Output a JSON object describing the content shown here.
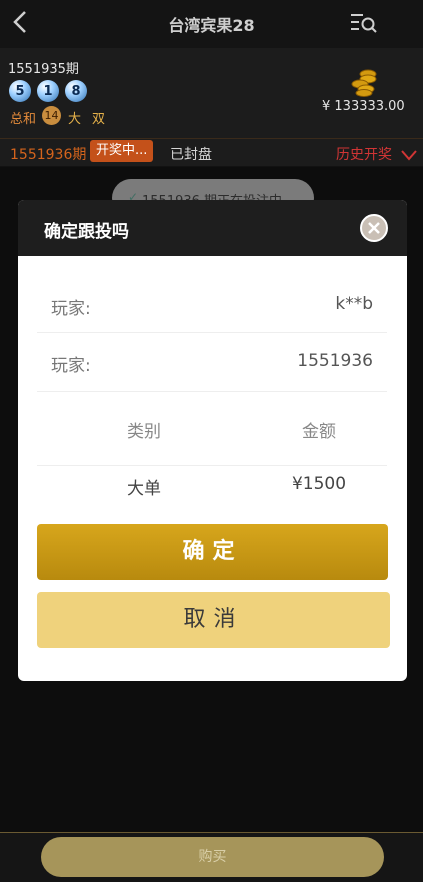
{
  "header": {
    "title": "台湾宾果28"
  },
  "info": {
    "period": "1551935期",
    "balls": [
      "5",
      "1",
      "8"
    ],
    "sum_label": "总和",
    "sum_value": "14",
    "size": "大",
    "parity": "双",
    "balance": "¥ 133333.00"
  },
  "status": {
    "current_period": "1551936期",
    "opening_badge": "开奖中...",
    "closed_label": "已封盘",
    "history_label": "历史开奖"
  },
  "toast": {
    "text": "1551936 期正在投注中"
  },
  "modal": {
    "title": "确定跟投吗",
    "rows": [
      {
        "label": "玩家:",
        "value": "k**b"
      },
      {
        "label": "玩家:",
        "value": "1551936"
      }
    ],
    "table": {
      "headers": [
        "类别",
        "金额"
      ],
      "row": [
        "大单",
        "¥1500"
      ]
    },
    "confirm_label": "确定",
    "cancel_label": "取消"
  },
  "footer": {
    "buy_label": "购买"
  },
  "colors": {
    "accent_gold": "#d7a61c",
    "cancel_bg": "#efd27c",
    "alert_red": "#d13535",
    "badge_orange": "#c4511a"
  },
  "icons": [
    "back-arrow-icon",
    "menu-search-icon",
    "coin-stack-icon",
    "chevron-down-icon",
    "close-icon",
    "check-icon"
  ]
}
